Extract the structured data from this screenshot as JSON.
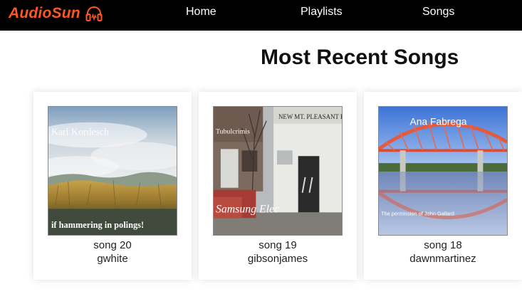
{
  "app": {
    "brand": "AudioSun",
    "brand_icon": "headphones-icon",
    "brand_color": "#ff5722"
  },
  "nav": {
    "home": "Home",
    "playlists": "Playlists",
    "songs": "Songs"
  },
  "main": {
    "title": "Most Recent Songs"
  },
  "songs": [
    {
      "title": "song 20",
      "artist": "gwhite",
      "cover_top_text": "Karl Kordesch",
      "cover_bottom_text": "if hammering in polings!"
    },
    {
      "title": "song 19",
      "artist": "gibsonjames",
      "cover_top_text": "Tubulcrimis",
      "cover_sign_text": "NEW MT. PLEASANT BAPTIST C",
      "cover_bottom_text": "Samsung Elec"
    },
    {
      "title": "song 18",
      "artist": "dawnmartinez",
      "cover_top_text": "Ana Fabrega",
      "cover_bottom_text": "The permission of John Gallard"
    }
  ]
}
